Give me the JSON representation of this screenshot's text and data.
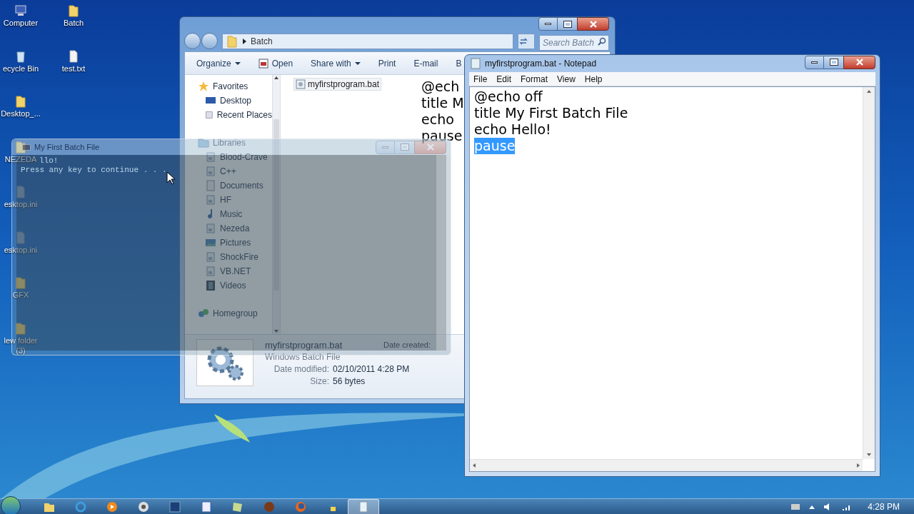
{
  "desktop": {
    "columns": [
      {
        "icons": [
          {
            "label": "Computer",
            "kind": "computer"
          },
          {
            "label": "ecycle Bin",
            "kind": "recycle"
          },
          {
            "label": "Desktop_...",
            "kind": "folder"
          },
          {
            "label": "NEZEDA",
            "kind": "folder"
          },
          {
            "label": "esktop.ini",
            "kind": "ini"
          },
          {
            "label": "esktop.ini",
            "kind": "ini"
          },
          {
            "label": "GFX",
            "kind": "folder"
          },
          {
            "label": "lew folder (3)",
            "kind": "folder"
          }
        ]
      },
      {
        "icons": [
          {
            "label": "Batch",
            "kind": "folder"
          },
          {
            "label": "test.txt",
            "kind": "text"
          }
        ]
      }
    ]
  },
  "explorer": {
    "address": "Batch",
    "search_placeholder": "Search Batch",
    "toolbar": [
      {
        "label": "Organize",
        "kind": "menu"
      },
      {
        "label": "Open",
        "kind": "icon"
      },
      {
        "label": "Share with",
        "kind": "menu"
      },
      {
        "label": "Print",
        "kind": "plain"
      },
      {
        "label": "E-mail",
        "kind": "plain"
      },
      {
        "label": "B",
        "kind": "plain"
      }
    ],
    "nav": [
      {
        "label": "Favorites",
        "kind": "star",
        "children": [
          {
            "label": "Desktop",
            "kind": "desktop"
          },
          {
            "label": "Recent Places",
            "kind": "recent"
          }
        ]
      },
      {
        "label": "Libraries",
        "kind": "libraries",
        "children": [
          {
            "label": "Blood-Crave",
            "kind": "library"
          },
          {
            "label": "C++",
            "kind": "library"
          },
          {
            "label": "Documents",
            "kind": "docs"
          },
          {
            "label": "HF",
            "kind": "library"
          },
          {
            "label": "Music",
            "kind": "music"
          },
          {
            "label": "Nezeda",
            "kind": "library"
          },
          {
            "label": "Pictures",
            "kind": "pictures"
          },
          {
            "label": "ShockFire",
            "kind": "library"
          },
          {
            "label": "VB.NET",
            "kind": "library"
          },
          {
            "label": "Videos",
            "kind": "videos"
          }
        ]
      },
      {
        "label": "Homegroup",
        "kind": "homegroup"
      }
    ],
    "files": [
      {
        "name": "myfirstprogram.bat",
        "selected": true
      }
    ],
    "preview_lines": [
      "@ech",
      "title M",
      "echo",
      "pause"
    ],
    "details": {
      "name": "myfirstprogram.bat",
      "type": "Windows Batch File",
      "fields": [
        {
          "label": "Date modified:",
          "value": "02/10/2011 4:28 PM"
        },
        {
          "label": "Size:",
          "value": "56 bytes"
        }
      ],
      "created_label": "Date created:"
    }
  },
  "console": {
    "title": "My First Batch File",
    "lines": [
      "llo!",
      "Press any key to continue . . ."
    ]
  },
  "notepad": {
    "title": "myfirstprogram.bat - Notepad",
    "menu": [
      "File",
      "Edit",
      "Format",
      "View",
      "Help"
    ],
    "lines": [
      {
        "text": "@echo off",
        "selected": false
      },
      {
        "text": "title My First Batch File",
        "selected": false
      },
      {
        "text": "echo Hello!",
        "selected": false
      },
      {
        "text": "pause",
        "selected": true
      }
    ]
  },
  "taskbar": {
    "apps": [
      {
        "kind": "explorer",
        "active": false
      },
      {
        "kind": "ie",
        "active": false
      },
      {
        "kind": "media",
        "active": false
      },
      {
        "kind": "chrome",
        "active": false
      },
      {
        "kind": "photoshop",
        "active": false
      },
      {
        "kind": "word",
        "active": false
      },
      {
        "kind": "notes",
        "active": false
      },
      {
        "kind": "globe",
        "active": false
      },
      {
        "kind": "firefox",
        "active": false
      },
      {
        "kind": "python",
        "active": false
      },
      {
        "kind": "notepad",
        "active": true
      }
    ],
    "clock": "4:28 PM"
  }
}
